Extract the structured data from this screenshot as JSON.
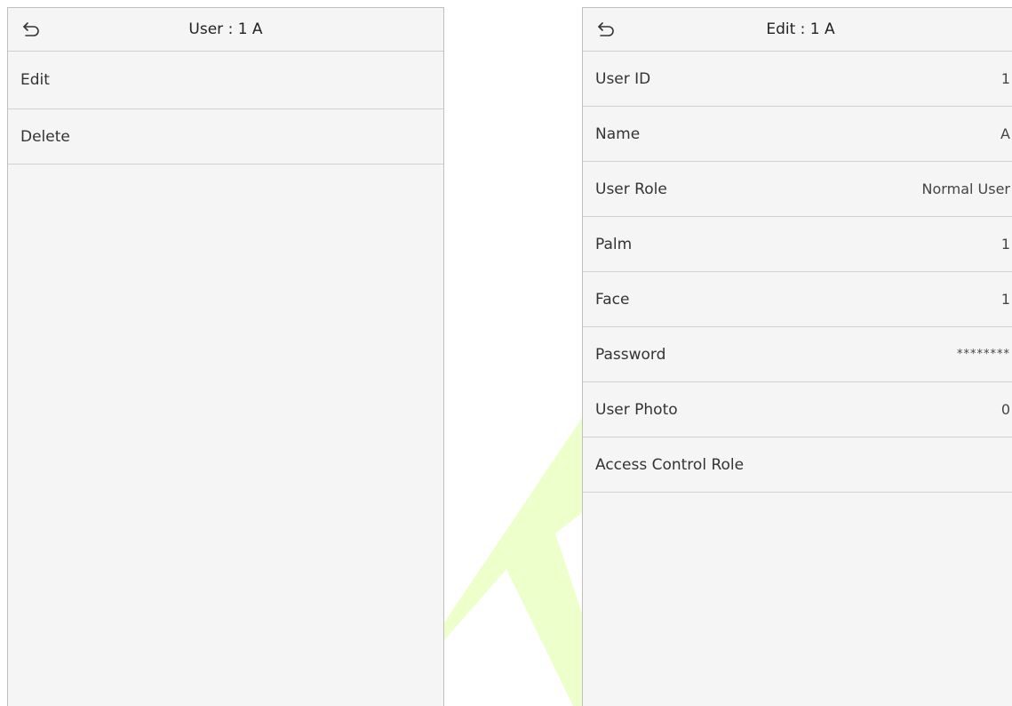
{
  "watermark_color": "#ccff66",
  "left_screen": {
    "title": "User : 1 A",
    "back_icon": "back-arrow-icon",
    "menu_items": [
      {
        "label": "Edit"
      },
      {
        "label": "Delete"
      }
    ]
  },
  "right_screen": {
    "title": "Edit : 1 A",
    "back_icon": "back-arrow-icon",
    "fields": [
      {
        "label": "User ID",
        "value": "1"
      },
      {
        "label": "Name",
        "value": "A"
      },
      {
        "label": "User Role",
        "value": "Normal User"
      },
      {
        "label": "Palm",
        "value": "1"
      },
      {
        "label": "Face",
        "value": "1"
      },
      {
        "label": "Password",
        "value": "********"
      },
      {
        "label": "User Photo",
        "value": "0"
      },
      {
        "label": "Access Control Role",
        "value": ""
      }
    ]
  }
}
